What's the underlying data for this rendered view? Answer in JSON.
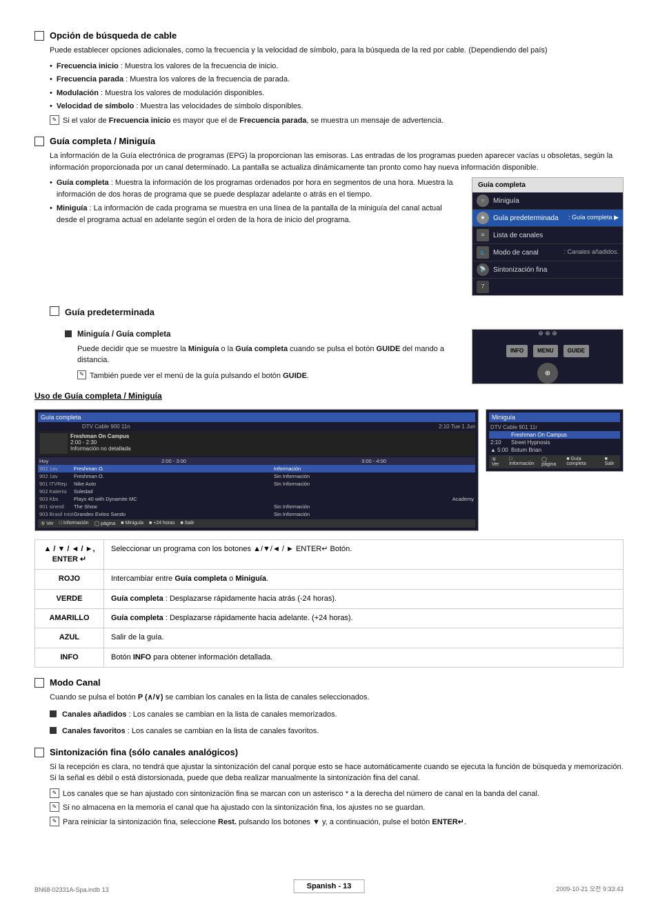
{
  "page": {
    "footer_left": "BN68-02331A-Spa.indb   13",
    "footer_center": "Spanish - 13",
    "footer_right": "2009-10-21   오전 9:33:43"
  },
  "section_cable": {
    "title": "Opción de búsqueda de cable",
    "description": "Puede establecer opciones adicionales, como la frecuencia y la velocidad de símbolo, para la búsqueda de la red por cable. (Dependiendo del país)",
    "bullets": [
      {
        "label": "Frecuencia inicio",
        "text": " : Muestra los valores de la frecuencia de inicio."
      },
      {
        "label": "Frecuencia parada",
        "text": " : Muestra los valores de la frecuencia de parada."
      },
      {
        "label": "Modulación",
        "text": " : Muestra los valores de modulación disponibles."
      },
      {
        "label": "Velocidad de símbolo",
        "text": " : Muestra las velocidades de símbolo disponibles."
      }
    ],
    "note": "Si el valor de Frecuencia inicio es mayor que el de Frecuencia parada, se muestra un mensaje de advertencia."
  },
  "section_guia": {
    "title": "Guía completa / Miniguía",
    "description": "La información de la Guía electrónica de programas (EPG) la proporcionan las emisoras. Las entradas de los programas pueden aparecer vacías u obsoletas, según la información proporcionada por un canal determinado. La pantalla se actualiza dinámicamente tan pronto como hay nueva información disponible.",
    "bullets": [
      {
        "label": "Guía completa",
        "text": " : Muestra la información de los programas ordenados por hora en segmentos de una hora. Muestra la información de dos horas de programa que se puede desplazar adelante o atrás en el tiempo."
      },
      {
        "label": "Miniguía",
        "text": " : La información de cada programa se muestra en una línea de la pantalla de la miniguía del canal actual desde el programa actual en adelante según el orden de la hora de inicio del programa."
      }
    ],
    "menu_rows": [
      {
        "label": "Guía completa",
        "type": "title"
      },
      {
        "icon": "circle",
        "label": "Miniguía",
        "value": ""
      },
      {
        "icon": "star",
        "label": "Guía predeterminada",
        "value": ": Guía completa ▶",
        "active": true
      },
      {
        "icon": "list",
        "label": "Lista de canales",
        "value": ""
      },
      {
        "icon": "tv",
        "label": "Modo de canal",
        "value": ": Canales añadidos."
      },
      {
        "icon": "antenna",
        "label": "Sintonización fina",
        "value": ""
      },
      {
        "icon": "num",
        "label": "",
        "value": ""
      }
    ]
  },
  "section_guia_pred": {
    "title": "Guía predeterminada",
    "sub_title": "Miniguía / Guía completa",
    "sub_description": "Puede decidir que se muestre la Miniguía o la Guía completa cuando se pulsa el botón GUIDE del mando a distancia.",
    "note": "También puede ver el menú de la guía pulsando el botón GUIDE."
  },
  "section_uso": {
    "title": "Uso de Guía completa / Miniguía",
    "guide_completa": {
      "label": "Guía completa",
      "header_info": "DTV Cable 900 11n      2:10 Tue 1 Jun",
      "prog_detail": "Freshman On Campus\n2:00 - 2:30\nInformación no detallada",
      "rows": [
        {
          "ch": "Hoy",
          "time1": "2:00 - 3:00",
          "time2": "3:00 - 4:00"
        },
        {
          "ch": "902 1av",
          "prog1": "Freshman O.",
          "prog2": "Información",
          "hl": true
        },
        {
          "ch": "902 1av",
          "prog1": "Freshman O.",
          "prog2": "Sin Información"
        },
        {
          "ch": "901 ITVRep",
          "prog1": "Nike Auto",
          "prog2": "Sin Información"
        },
        {
          "ch": "902 Katerisi",
          "prog1": "Soledad",
          "prog2": ""
        },
        {
          "ch": "903 Kbs",
          "prog1": "Plays 40 with Dynamite MC",
          "prog2": "Academy"
        },
        {
          "ch": "901 sinestl",
          "prog1": "The Show",
          "prog2": "Sin Información"
        },
        {
          "ch": "903 Brasil Inist",
          "prog1": "Grandes Exitos Sando",
          "prog2": "Sin Información"
        }
      ],
      "bottom_bar": "⑤ Ver    □ Información ◯ página ■ Miniguía ■ +24 horas ■ Salir"
    },
    "miniguia": {
      "label": "Miniguía",
      "header": "DTV Cable 901 11r",
      "rows": [
        {
          "time": "",
          "prog": "Freshman On Campus",
          "hl": true
        },
        {
          "time": "2:10",
          "prog": "Street Hypnosis"
        },
        {
          "time": "▲ 5:00",
          "prog": "Botum Brian"
        }
      ],
      "bottom_bar": "⑤ Ver    □ Información ◯ página ■ Guía completa ■ Salir"
    }
  },
  "key_table": {
    "rows": [
      {
        "key": "▲ / ▼ / ◄ / ►,\nENTER ↵",
        "description": "Seleccionar un programa con los botones ▲/▼/◄ / ► ENTER↵ Botón."
      },
      {
        "key": "ROJO",
        "description_parts": [
          "Intercambiar entre ",
          "Guía completa",
          " o ",
          "Miniguía",
          "."
        ]
      },
      {
        "key": "VERDE",
        "description_parts": [
          "Guía completa",
          " : Desplazarse rápidamente hacia atrás (-24 horas)."
        ]
      },
      {
        "key": "AMARILLO",
        "description_parts": [
          "Guía completa",
          " : Desplazarse rápidamente hacia adelante. (+24 horas)."
        ]
      },
      {
        "key": "AZUL",
        "description": "Salir de la guía."
      },
      {
        "key": "INFO",
        "description_parts": [
          "Botón ",
          "INFO",
          " para obtener información detallada."
        ]
      }
    ]
  },
  "section_modo_canal": {
    "title": "Modo Canal",
    "description": "Cuando se pulsa el botón P (∧/∨) se cambian los canales en la lista de canales seleccionados.",
    "bullets": [
      {
        "label": "Canales añadidos",
        "text": " : Los canales se cambian en la lista de canales memorizados."
      },
      {
        "label": "Canales favoritos",
        "text": " : Los canales se cambian en la lista de canales favoritos."
      }
    ]
  },
  "section_sint": {
    "title": "Sintonización fina",
    "title_suffix": " (sólo canales analógicos)",
    "description": "Si la recepción es clara, no tendrá que ajustar la sintonización del canal porque esto se hace automáticamente cuando se ejecuta la función de búsqueda y memorización. Si la señal es débil o está distorsionada, puede que deba realizar manualmente la sintonización fina del canal.",
    "notes": [
      "Los canales que se han ajustado con sintonización fina se marcan con un asterisco * a la derecha del número de canal en la banda del canal.",
      "Si no almacena en la memoria el canal que ha ajustado con la sintonización fina, los ajustes no se guardan.",
      "Para reiniciar la sintonización fina, seleccione Rest. pulsando los botones ▼ y, a continuación, pulse el botón ENTER↵."
    ]
  }
}
